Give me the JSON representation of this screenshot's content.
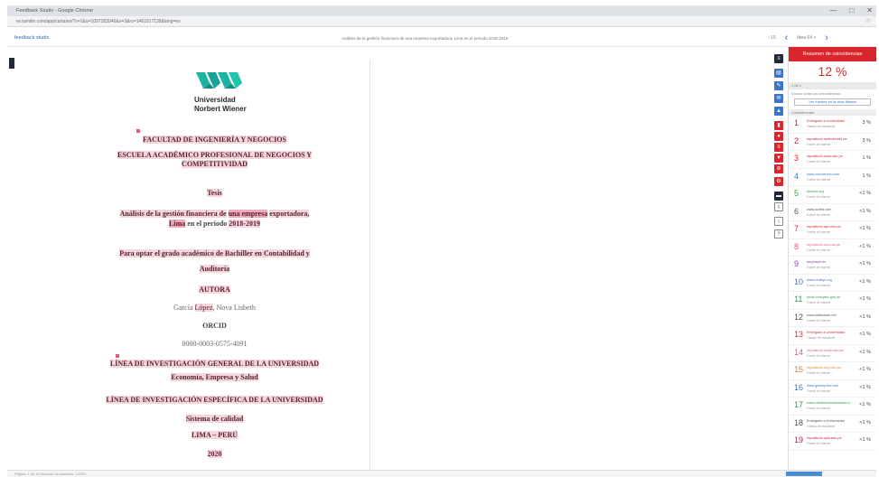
{
  "window": {
    "title": "Feedback Studio - Google Chrome",
    "controls": [
      "—",
      "□",
      "✕"
    ]
  },
  "address": {
    "url": "ev.turnitin.com/app/carta/es/?s=1&u=1097283046&o=3&ro=1461917139&lang=es"
  },
  "app": {
    "brand": "feedback studio",
    "doc_title": "Análisis de la gestión financiera de una empresa exportadora, Lima en el periodo 2018-2019",
    "nav_prev": "‹",
    "nav_next": "›",
    "page_indicator": "Idea 64 >",
    "zoom": "- 15"
  },
  "document": {
    "university_line1": "Universidad",
    "university_line2": "Norbert Wiener",
    "faculty": "FACULTAD DE INGENIERÍA Y NEGOCIOS",
    "school_line1": "ESCUELA ACADÉMICO PROFESIONAL DE NEGOCIOS Y",
    "school_line2": "COMPETITIVIDAD",
    "thesis": "Tesis",
    "title_a": "Análisis de la gestión financiera de",
    "title_b": "una empresa",
    "title_c": "exportadora,",
    "title_d": "Lima",
    "title_e": "en el periodo",
    "title_f": "2018-2019",
    "degree_line1": "Para optar el grado académico de Bachiller en Contabilidad y",
    "degree_line2": "Auditoría",
    "author_label": "AUTORA",
    "author_a": "García",
    "author_b": "López",
    "author_c": ", Nova Lisbeth",
    "orcid_label": "ORCID",
    "orcid": "0000-0003-0575-4091",
    "line_general": "LÍNEA DE INVESTIGACIÓN GENERAL DE LA UNIVERSIDAD",
    "line_general_value": "Economía, Empresa y Salud",
    "line_specific": "LÍNEA DE INVESTIGACIÓN ESPECÍFICA DE LA UNIVERSIDAD",
    "line_specific_value": "Sistema de calidad",
    "city": "LIMA – PERÚ",
    "year": "2020"
  },
  "panel": {
    "header": "Resumen de coincidencias",
    "percent": "12 %",
    "section_label": "1 de 1",
    "filter_text": "Excluir todas las coincidencias",
    "button_label": "Ver fuentes en la vista filtrada",
    "list_label": "Coincidencias",
    "matches": [
      {
        "n": "1",
        "src": "Entregado a Universidad",
        "sub": "Trabajo del estudiante",
        "val": "3 %",
        "color": "#d9262c"
      },
      {
        "n": "2",
        "src": "repositorio.uwiener.edu.pe",
        "sub": "Fuente de Internet",
        "val": "3 %",
        "color": "#c2185b"
      },
      {
        "n": "3",
        "src": "repositorio.unac.edu.pe",
        "sub": "Fuente de Internet",
        "val": "1 %",
        "color": "#d9262c"
      },
      {
        "n": "4",
        "src": "www.coursehero.com",
        "sub": "Fuente de Internet",
        "val": "1 %",
        "color": "#3b73c9"
      },
      {
        "n": "5",
        "src": "archive.org",
        "sub": "Fuente de Internet",
        "val": "<1 %",
        "color": "#2e9e4f"
      },
      {
        "n": "6",
        "src": "www.scribd.com",
        "sub": "Fuente de Internet",
        "val": "<1 %",
        "color": "#555555"
      },
      {
        "n": "7",
        "src": "repositorio.upn.edu.pe",
        "sub": "Fuente de Internet",
        "val": "<1 %",
        "color": "#d9262c"
      },
      {
        "n": "8",
        "src": "repositorio.ucv.edu.pe",
        "sub": "Fuente de Internet",
        "val": "<1 %",
        "color": "#e05b7a"
      },
      {
        "n": "9",
        "src": "docplayer.es",
        "sub": "Fuente de Internet",
        "val": "<1 %",
        "color": "#8e44ad"
      },
      {
        "n": "10",
        "src": "www.redalyc.org",
        "sub": "Fuente de Internet",
        "val": "<1 %",
        "color": "#3b73c9"
      },
      {
        "n": "11",
        "src": "alicia.concytec.gob.pe",
        "sub": "Fuente de Internet",
        "val": "<1 %",
        "color": "#2e9e4f"
      },
      {
        "n": "12",
        "src": "www.slideshare.net",
        "sub": "Fuente de Internet",
        "val": "<1 %",
        "color": "#555555"
      },
      {
        "n": "13",
        "src": "Entregado a Universidad",
        "sub": "Trabajo del estudiante",
        "val": "<1 %",
        "color": "#d9262c"
      },
      {
        "n": "14",
        "src": "repositorio.usmp.edu.pe",
        "sub": "Fuente de Internet",
        "val": "<1 %",
        "color": "#e05b7a"
      },
      {
        "n": "15",
        "src": "repositorio.unp.edu.pe",
        "sub": "Fuente de Internet",
        "val": "<1 %",
        "color": "#e67e22"
      },
      {
        "n": "16",
        "src": "www.gestiopolis.com",
        "sub": "Fuente de Internet",
        "val": "<1 %",
        "color": "#3b73c9"
      },
      {
        "n": "17",
        "src": "www.caballerobustamante.com",
        "sub": "Fuente de Internet",
        "val": "<1 %",
        "color": "#2e9e4f"
      },
      {
        "n": "18",
        "src": "Entregado a Universidad",
        "sub": "Trabajo del estudiante",
        "val": "<1 %",
        "color": "#555555"
      },
      {
        "n": "19",
        "src": "repositorio.upla.edu.pe",
        "sub": "Fuente de Internet",
        "val": "<1 %",
        "color": "#c2185b"
      }
    ]
  },
  "status": {
    "text": "Página: 1 de 64   Número de palabras: 12345"
  },
  "colors": {
    "accent": "#d9262c",
    "highlight": "#f5d6dc",
    "logo_teal": "#1fb3a6",
    "link": "#3b73c9"
  }
}
